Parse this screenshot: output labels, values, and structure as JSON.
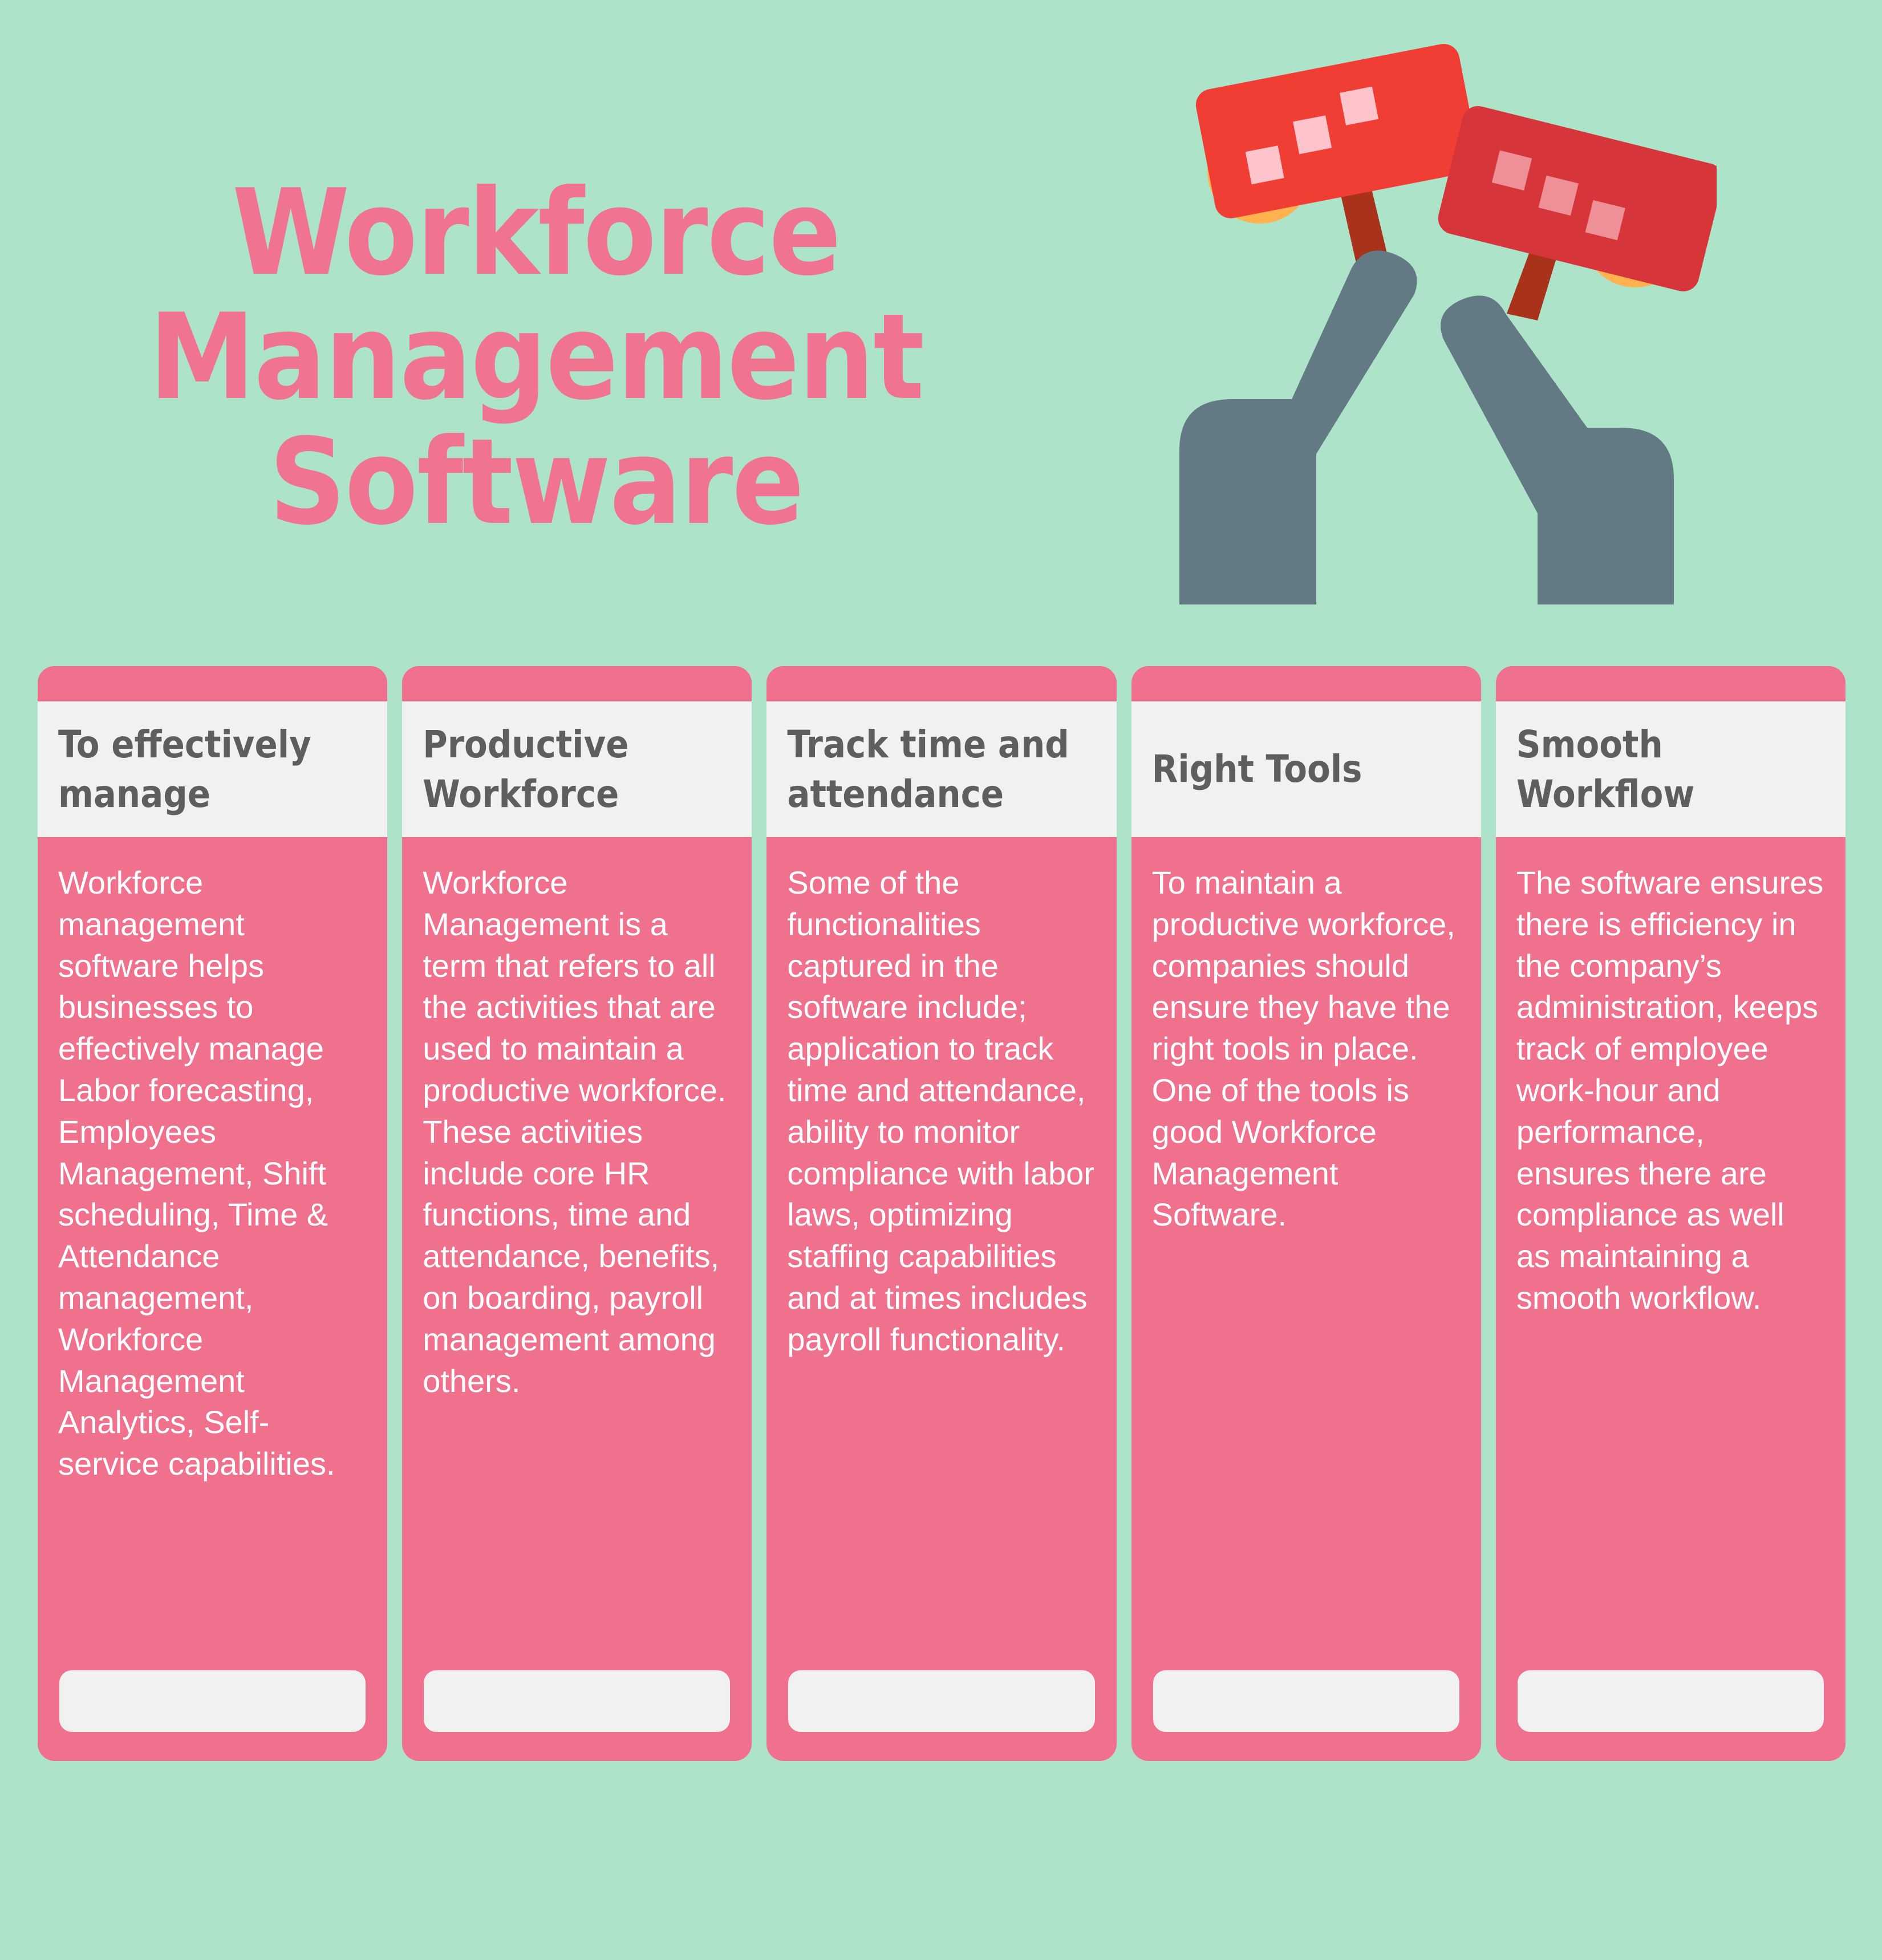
{
  "colors": {
    "background_mint": "#ade3c8",
    "accent_pink": "#ef718e",
    "title_pink": "#f0748f",
    "panel_white": "#f1f1f1",
    "heading_gray": "#5e5e5e",
    "sign_red_light": "#f03e35",
    "sign_red_dark": "#d6353a",
    "sign_square_light": "#ffc4cb",
    "sign_square_dark": "#ef9099",
    "stick_brown": "#a8321a",
    "body_slate": "#637a85",
    "head_orange": "#ffb24d"
  },
  "hero": {
    "title": "Workforce\nManagement\nSoftware",
    "illustration_name": "two-people-holding-protest-signs"
  },
  "cards": [
    {
      "header": "To effectively manage",
      "body": "Workforce management software helps businesses to effectively manage  Labor forecasting, Employees Management, Shift scheduling, Time & Attendance management, Workforce Management Analytics, Self-service capabilities.",
      "footer": ""
    },
    {
      "header": "Productive Workforce",
      "body": "Workforce Management is a term that refers to all the activities that  are used to maintain a productive workforce. These activities include core HR functions, time and attendance, benefits, on boarding, payroll management among others.",
      "footer": ""
    },
    {
      "header": "Track time and attendance",
      "body": "Some of the functionalities captured in the software include; application to track time and attendance, ability to monitor compliance  with labor laws, optimizing staffing capabilities and at times includes payroll functionality.",
      "footer": ""
    },
    {
      "header": "Right Tools",
      "body": "To maintain a productive workforce, companies should ensure they have  the right tools in place. One of the tools is good Workforce Management Software.",
      "footer": ""
    },
    {
      "header": "Smooth Workflow",
      "body": "The software ensures there is efficiency in the company’s administration, keeps track of employee work-hour and performance, ensures there are compliance as well as maintaining a smooth workflow.",
      "footer": ""
    }
  ]
}
